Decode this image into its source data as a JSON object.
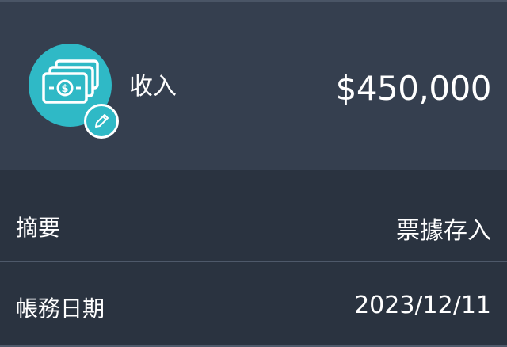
{
  "header": {
    "category_icon": "money-bills-icon",
    "edit_icon": "pencil-icon",
    "category_label": "收入",
    "amount": "$450,000"
  },
  "details": {
    "summary_label": "摘要",
    "summary_value": "票據存入",
    "date_label": "帳務日期",
    "date_value": "2023/12/11"
  },
  "colors": {
    "accent": "#2fb9c6",
    "header_bg": "#353f4f",
    "body_bg": "#2a3340",
    "text": "#ffffff"
  }
}
